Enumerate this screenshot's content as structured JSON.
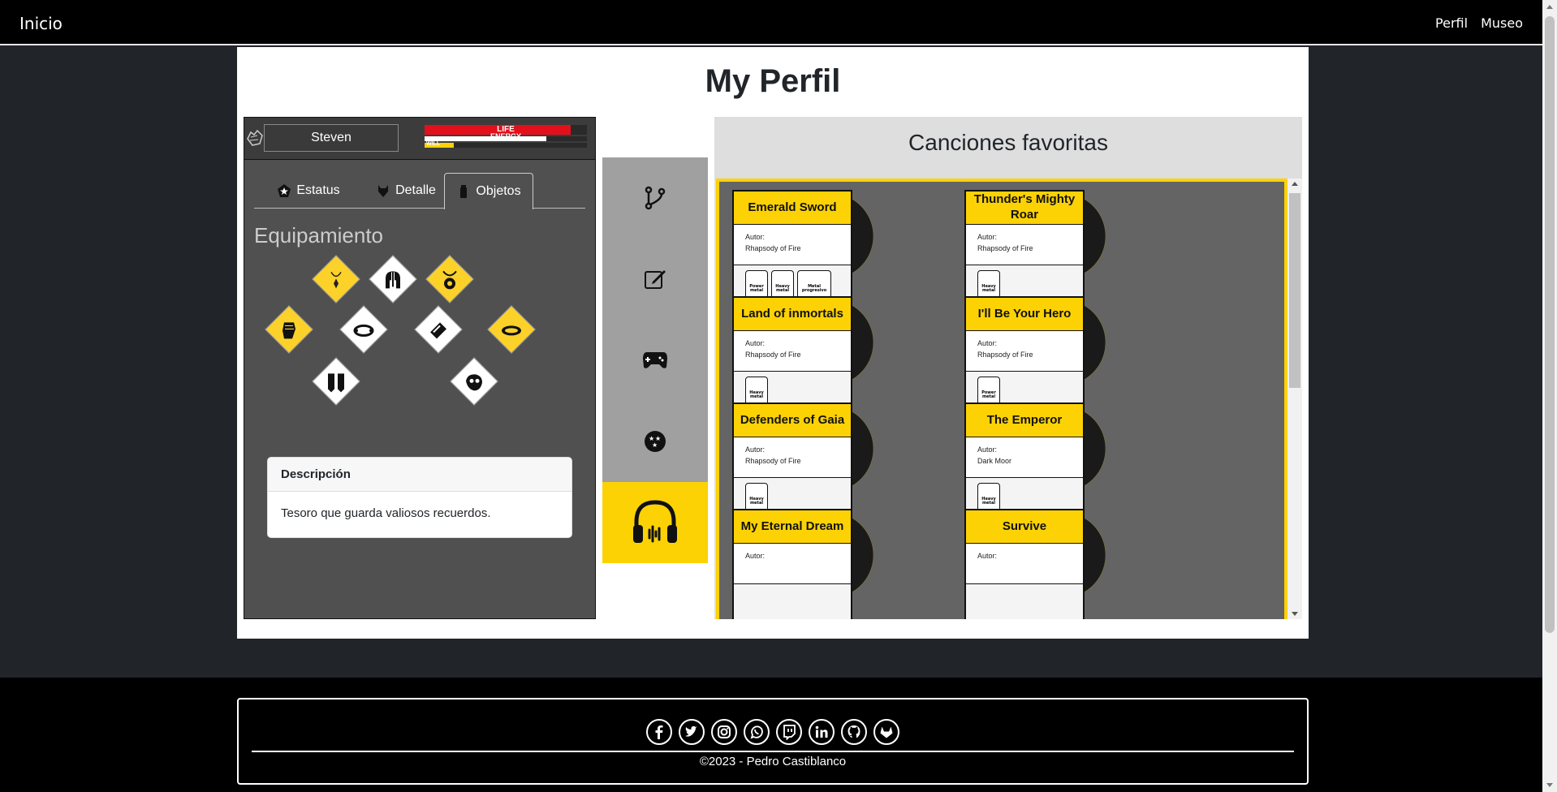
{
  "navbar": {
    "brand": "Inicio",
    "links": [
      "Perfil",
      "Museo"
    ]
  },
  "page": {
    "title": "My Perfil"
  },
  "character": {
    "name": "Steven",
    "bars": [
      {
        "label": "LIFE",
        "value": 0.9,
        "color": "#e3101c"
      },
      {
        "label": "ENERGY",
        "value": 0.75,
        "color": "#ffffff"
      },
      {
        "label": "WILL",
        "value": 0.18,
        "color": "#fcd205"
      }
    ],
    "tabs": [
      {
        "label": "Estatus",
        "icon": "pentagon-star-icon",
        "active": false
      },
      {
        "label": "Detalle",
        "icon": "wolf-head-icon",
        "active": false
      },
      {
        "label": "Objetos",
        "icon": "flask-icon",
        "active": true
      }
    ],
    "section_title": "Equipamiento",
    "equipment": [
      {
        "name": "necklace-icon",
        "color": "yellow"
      },
      {
        "name": "helmet-icon",
        "color": "white"
      },
      {
        "name": "amulet-icon",
        "color": "yellow"
      },
      {
        "name": "gauntlet-icon",
        "color": "yellow"
      },
      {
        "name": "bracelet-icon",
        "color": "white"
      },
      {
        "name": "bracer-icon",
        "color": "white"
      },
      {
        "name": "ring-icon",
        "color": "yellow"
      },
      {
        "name": "greaves-icon",
        "color": "white"
      },
      {
        "name": "mask-icon",
        "color": "white"
      }
    ],
    "description": {
      "title": "Descripción",
      "text": "Tesoro que guarda valiosos recuerdos."
    }
  },
  "sidebar": [
    {
      "name": "git-branch-icon",
      "active": false
    },
    {
      "name": "edit-icon",
      "active": false
    },
    {
      "name": "gamepad-icon",
      "active": false
    },
    {
      "name": "ball-stars-icon",
      "active": false
    },
    {
      "name": "headphones-icon",
      "active": true
    }
  ],
  "songs": {
    "title": "Canciones favoritas",
    "author_label": "Autor:",
    "items": [
      {
        "title": "Emerald Sword",
        "author": "Rhapsody of Fire",
        "tags": [
          "Power metal",
          "Heavy metal",
          "Metal progresivo"
        ]
      },
      {
        "title": "Thunder's Mighty Roar",
        "author": "Rhapsody of Fire",
        "tags": [
          "Heavy metal"
        ]
      },
      {
        "title": "Land of inmortals",
        "author": "Rhapsody of Fire",
        "tags": [
          "Heavy metal"
        ]
      },
      {
        "title": "I'll Be Your Hero",
        "author": "Rhapsody of Fire",
        "tags": [
          "Power metal"
        ]
      },
      {
        "title": "Defenders of Gaia",
        "author": "Rhapsody of Fire",
        "tags": [
          "Heavy metal"
        ]
      },
      {
        "title": "The Emperor",
        "author": "Dark Moor",
        "tags": [
          "Heavy metal"
        ]
      },
      {
        "title": "My Eternal Dream",
        "author": "",
        "tags": []
      },
      {
        "title": "Survive",
        "author": "",
        "tags": []
      }
    ]
  },
  "footer": {
    "socials": [
      "facebook-icon",
      "twitter-icon",
      "instagram-icon",
      "whatsapp-icon",
      "twitch-icon",
      "linkedin-icon",
      "github-icon",
      "gitlab-icon"
    ],
    "copyright": "©2023 - Pedro Castiblanco"
  }
}
